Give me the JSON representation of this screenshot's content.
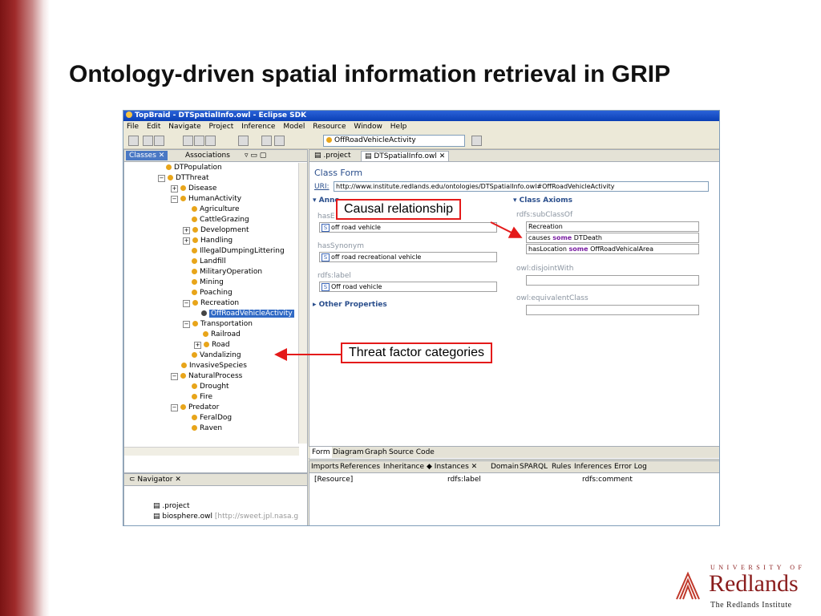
{
  "slide": {
    "title": "Ontology-driven spatial information retrieval in GRIP"
  },
  "window": {
    "title": "TopBraid - DTSpatialInfo.owl - Eclipse SDK",
    "menu": [
      "File",
      "Edit",
      "Navigate",
      "Project",
      "Inference",
      "Model",
      "Resource",
      "Window",
      "Help"
    ],
    "toolbar_combo": "OffRoadVehicleActivity"
  },
  "classes_view": {
    "tabs": [
      "Classes",
      "Associations"
    ],
    "tree": [
      {
        "label": "DTPopulation"
      },
      {
        "label": "DTThreat"
      },
      {
        "label": "Disease"
      },
      {
        "label": "HumanActivity"
      },
      {
        "label": "Agriculture"
      },
      {
        "label": "CattleGrazing"
      },
      {
        "label": "Development"
      },
      {
        "label": "Handling"
      },
      {
        "label": "IllegalDumpingLittering"
      },
      {
        "label": "Landfill"
      },
      {
        "label": "MilitaryOperation"
      },
      {
        "label": "Mining"
      },
      {
        "label": "Poaching"
      },
      {
        "label": "Recreation"
      },
      {
        "label": "OffRoadVehicleActivity"
      },
      {
        "label": "Transportation"
      },
      {
        "label": "Railroad"
      },
      {
        "label": "Road"
      },
      {
        "label": "Vandalizing"
      },
      {
        "label": "InvasiveSpecies"
      },
      {
        "label": "NaturalProcess"
      },
      {
        "label": "Drought"
      },
      {
        "label": "Fire"
      },
      {
        "label": "Predator"
      },
      {
        "label": "FeralDog"
      },
      {
        "label": "Raven"
      }
    ]
  },
  "navigator": {
    "tab": "Navigator",
    "items": [
      ".project",
      "biosphere.owl",
      "[http://sweet.jpl.nasa.g"
    ]
  },
  "editor": {
    "tabs": [
      ".project",
      "DTSpatialInfo.owl"
    ],
    "form_title": "Class Form",
    "uri_label": "URI:",
    "uri": "http://www.institute.redlands.edu/ontologies/DTSpatialInfo.owl#OffRoadVehicleActivity",
    "annotations_head": "Anno",
    "has_label": "hasE",
    "has_value": "off road vehicle",
    "synonym_label": "hasSynonym",
    "synonym_value": "off road recreational vehicle",
    "rdfs_label": "rdfs:label",
    "rdfs_value": "Off road vehicle",
    "other_props": "Other Properties",
    "class_axioms": "Class Axioms",
    "subclassof": "rdfs:subClassOf",
    "sub1": "Recreation",
    "sub2_pre": "causes",
    "sub2_kw": "some",
    "sub2_post": "DTDeath",
    "sub3_pre": "hasLocation",
    "sub3_kw": "some",
    "sub3_post": "OffRoadVehicalArea",
    "disjoint": "owl:disjointWith",
    "equivalent": "owl:equivalentClass",
    "bottom_tabs": [
      "Form",
      "Diagram",
      "Graph",
      "Source Code"
    ]
  },
  "views": {
    "tabs": [
      "Imports",
      "References",
      "Inheritance",
      "Instances",
      "Domain",
      "SPARQL",
      "Rules",
      "Inferences",
      "Error Log"
    ],
    "columns": [
      "[Resource]",
      "rdfs:label",
      "rdfs:comment"
    ]
  },
  "callouts": {
    "causal": "Causal relationship",
    "threat": "Threat factor categories"
  },
  "logo": {
    "university": "UNIVERSITY OF",
    "name": "Redlands",
    "subtitle": "The Redlands Institute"
  },
  "colors": {
    "callout_border": "#e41a1a",
    "brand": "#8a1c1c",
    "selection": "#316ac5"
  }
}
